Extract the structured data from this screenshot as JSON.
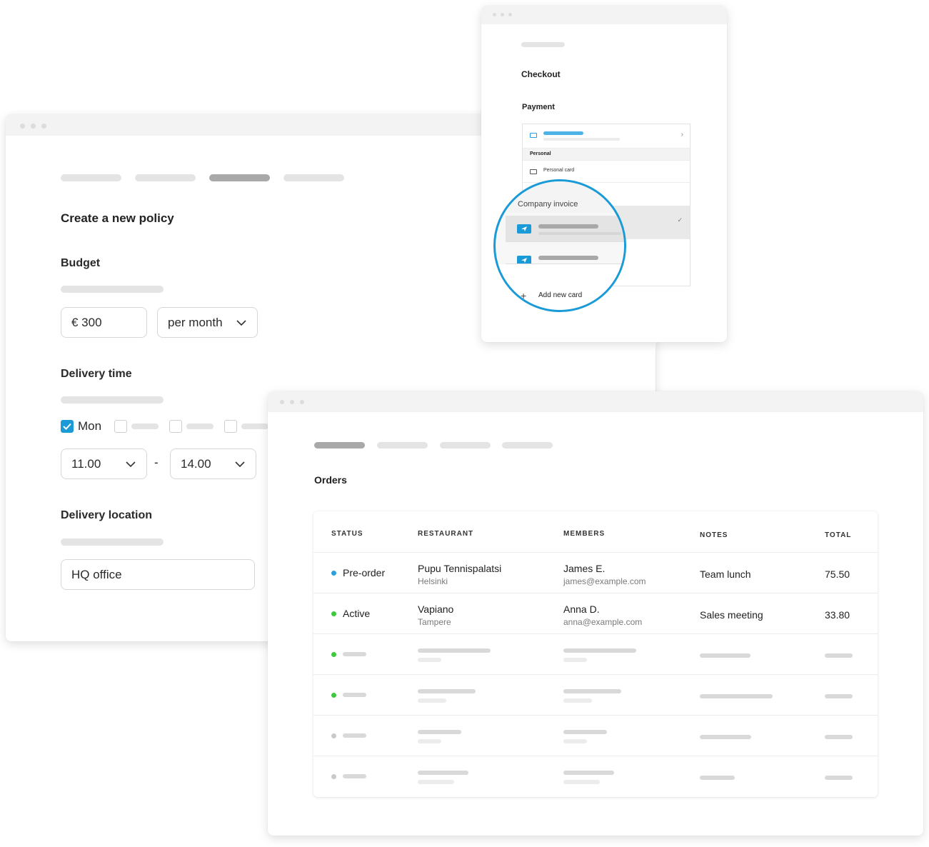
{
  "policy": {
    "title": "Create a new policy",
    "budget_label": "Budget",
    "budget_value": "€ 300",
    "budget_period": "per month",
    "delivery_time_label": "Delivery time",
    "day_checked_label": "Mon",
    "time_start": "11.00",
    "time_separator": "-",
    "time_end": "14.00",
    "delivery_location_label": "Delivery location",
    "delivery_location_value": "HQ office"
  },
  "checkout": {
    "title": "Checkout",
    "payment_label": "Payment",
    "personal_header": "Personal",
    "personal_card_label": "Personal card",
    "company_invoice_label": "Company invoice",
    "add_new_card_label": "Add new card"
  },
  "orders": {
    "title": "Orders",
    "columns": {
      "status": "STATUS",
      "restaurant": "RESTAURANT",
      "members": "MEMBERS",
      "notes": "NOTES",
      "total": "TOTAL"
    },
    "rows": [
      {
        "status": "Pre-order",
        "status_color": "#2ba0df",
        "restaurant": "Pupu Tennispalatsi",
        "city": "Helsinki",
        "member": "James E.",
        "email": "james@example.com",
        "notes": "Team lunch",
        "total": "75.50"
      },
      {
        "status": "Active",
        "status_color": "#3ec83e",
        "restaurant": "Vapiano",
        "city": "Tampere",
        "member": "Anna D.",
        "email": "anna@example.com",
        "notes": "Sales meeting",
        "total": "33.80"
      }
    ],
    "placeholder_status_colors": [
      "#3ec83e",
      "#3ec83e",
      "#c9c9c9",
      "#c9c9c9"
    ]
  },
  "colors": {
    "accent": "#1a9ad6"
  }
}
